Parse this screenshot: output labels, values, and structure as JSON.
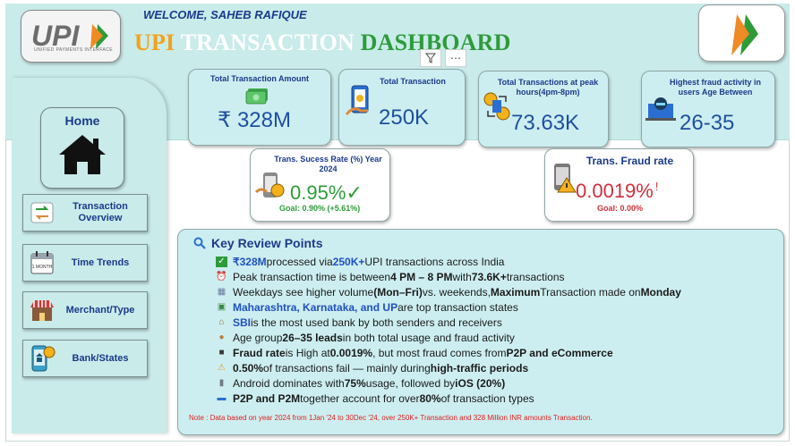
{
  "header": {
    "welcome": "WELCOME,  SAHEB RAFIQUE",
    "title_part1": "UPI ",
    "title_part2": "TRANSACTION ",
    "title_part3": "DASHBOARD",
    "upi_logo_text": "UPI",
    "upi_logo_sub": "UNIFIED PAYMENTS INTERFACE"
  },
  "colors": {
    "band": "#c9ebea",
    "card": "#cdeef0",
    "navy": "#1b3a8a",
    "value_blue": "#1f4fa0",
    "success_green": "#2e9b3a",
    "fraud_red": "#d0303c",
    "saffron": "#f3a21a"
  },
  "kpis": {
    "total_amount": {
      "label": "Total Transaction Amount",
      "value": "₹ 328M",
      "icon": "money-icon"
    },
    "total_txn": {
      "label": "Total Transaction",
      "value": "250K",
      "icon": "phone-payment-icon"
    },
    "peak": {
      "label": "Total Transactions at peak hours(4pm-8pm)",
      "value": "73.63K",
      "icon": "exchange-icon"
    },
    "fraud_age": {
      "label": "Highest fraud activity in users Age Between",
      "value": "26-35",
      "icon": "hacker-icon"
    },
    "success_rate": {
      "label": "Trans. Sucess Rate (%) Year 2024",
      "value": "0.95%",
      "mark": "✓",
      "goal": "Goal: 0.90% (+5.61%)",
      "icon": "secure-phone-icon"
    },
    "fraud_rate": {
      "label": "Trans. Fraud rate",
      "value": "0.0019%",
      "mark": "!",
      "goal": "Goal: 0.00%",
      "icon": "warning-phone-icon"
    }
  },
  "sidebar": {
    "home": "Home",
    "items": [
      {
        "label": "Transaction Overview",
        "icon": "transfer-icon"
      },
      {
        "label": "Time Trends",
        "icon": "calendar-icon"
      },
      {
        "label": "Merchant/Type",
        "icon": "store-icon"
      },
      {
        "label": "Bank/States",
        "icon": "mobile-bank-icon"
      }
    ],
    "calendar_text": "1 MONTH"
  },
  "review": {
    "title": "Key Review Points",
    "points": [
      {
        "icon": "check-icon",
        "parts": [
          [
            "b-blue",
            "₹328M"
          ],
          [
            "n",
            " processed via "
          ],
          [
            "b-blue",
            "250K+"
          ],
          [
            "n",
            " UPI transactions across India"
          ]
        ]
      },
      {
        "icon": "alarm-icon",
        "parts": [
          [
            "n",
            "Peak transaction time is between "
          ],
          [
            "b",
            "4 PM – 8 PM"
          ],
          [
            "n",
            " with "
          ],
          [
            "b",
            "73.6K+"
          ],
          [
            "n",
            " transactions"
          ]
        ]
      },
      {
        "icon": "calendar-icon",
        "parts": [
          [
            "n",
            "Weekdays see higher volume "
          ],
          [
            "b",
            "(Mon–Fri)"
          ],
          [
            "n",
            " vs. weekends, "
          ],
          [
            "b",
            "Maximum"
          ],
          [
            "n",
            " Transaction made on "
          ],
          [
            "b",
            "Monday"
          ]
        ]
      },
      {
        "icon": "map-icon",
        "parts": [
          [
            "b-blue",
            "Maharashtra, Karnataka, and UP"
          ],
          [
            "n",
            " are top transaction states"
          ]
        ]
      },
      {
        "icon": "bank-icon",
        "parts": [
          [
            "b-blue",
            "SBI"
          ],
          [
            "n",
            " is the most used bank by both senders and receivers"
          ]
        ]
      },
      {
        "icon": "person-icon",
        "parts": [
          [
            "n",
            "Age group "
          ],
          [
            "b",
            "26–35 leads"
          ],
          [
            "n",
            " in both total usage and fraud activity"
          ]
        ]
      },
      {
        "icon": "fraud-icon",
        "parts": [
          [
            "b",
            "Fraud rate"
          ],
          [
            "n",
            " is High at "
          ],
          [
            "b",
            "0.0019%"
          ],
          [
            "n",
            ", but most fraud comes from "
          ],
          [
            "b",
            "P2P and eCommerce"
          ]
        ]
      },
      {
        "icon": "warning-icon",
        "parts": [
          [
            "b",
            "0.50%"
          ],
          [
            "n",
            " of transactions fail — mainly during "
          ],
          [
            "b",
            "high-traffic periods"
          ]
        ]
      },
      {
        "icon": "phone-icon",
        "parts": [
          [
            "n",
            "Android dominates with "
          ],
          [
            "b",
            "75%"
          ],
          [
            "n",
            " usage, followed by "
          ],
          [
            "b",
            "iOS (20%)"
          ]
        ]
      },
      {
        "icon": "card-icon",
        "parts": [
          [
            "b",
            "P2P and P2M"
          ],
          [
            "n",
            " together account for over "
          ],
          [
            "b",
            "80%"
          ],
          [
            "n",
            " of transaction types"
          ]
        ]
      }
    ],
    "note": "Note  : Data based on year 2024 from 1Jan '24 to 30Dec '24, over 250K+ Transaction and 328 Million INR amounts Transaction."
  }
}
